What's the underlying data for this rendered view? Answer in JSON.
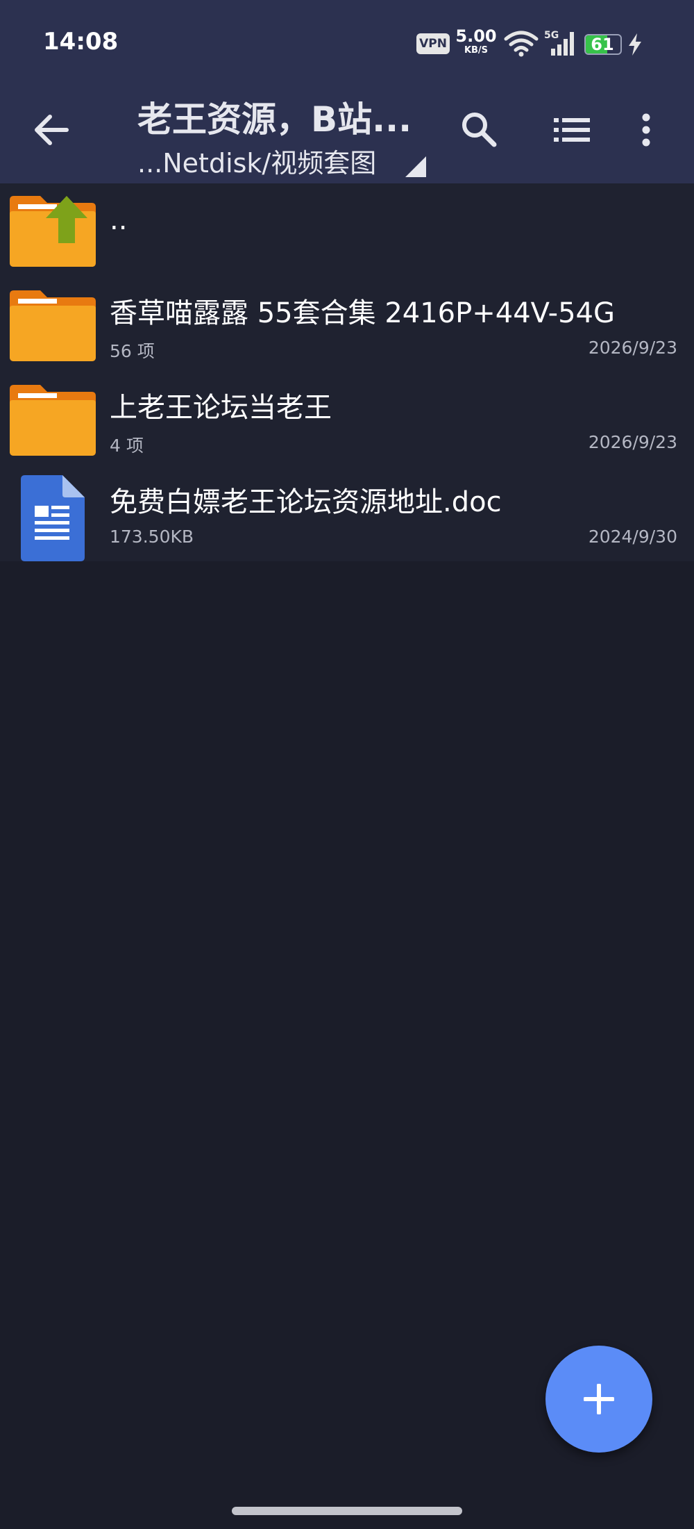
{
  "status_bar": {
    "time": "14:08",
    "vpn_label": "VPN",
    "net_speed_value": "5.00",
    "net_speed_unit": "KB/S",
    "signal_label": "5G",
    "battery_percent": "61"
  },
  "app_bar": {
    "title": "老王资源，B站...",
    "path": "...Netdisk/视频套图",
    "icons": [
      "back-arrow-icon",
      "search-icon",
      "list-view-icon",
      "more-vertical-icon"
    ]
  },
  "files": [
    {
      "name": "..",
      "type": "parent-folder"
    },
    {
      "name": "香草喵露露 55套合集 2416P+44V-54G",
      "meta": "56 项",
      "date": "2026/9/23",
      "type": "folder"
    },
    {
      "name": "上老王论坛当老王",
      "meta": "4 项",
      "date": "2026/9/23",
      "type": "folder"
    },
    {
      "name": "免费白嫖老王论坛资源地址.doc",
      "meta": "173.50KB",
      "date": "2024/9/30",
      "type": "document"
    }
  ],
  "colors": {
    "toolbar": "#2c3150",
    "background": "#1b1d29",
    "row": "#1f2230",
    "folder": "#f6a623",
    "folder_tab": "#e87a10",
    "up_arrow": "#7ea21a",
    "doc_icon": "#3b6fd6",
    "fab": "#5b8cf7"
  }
}
